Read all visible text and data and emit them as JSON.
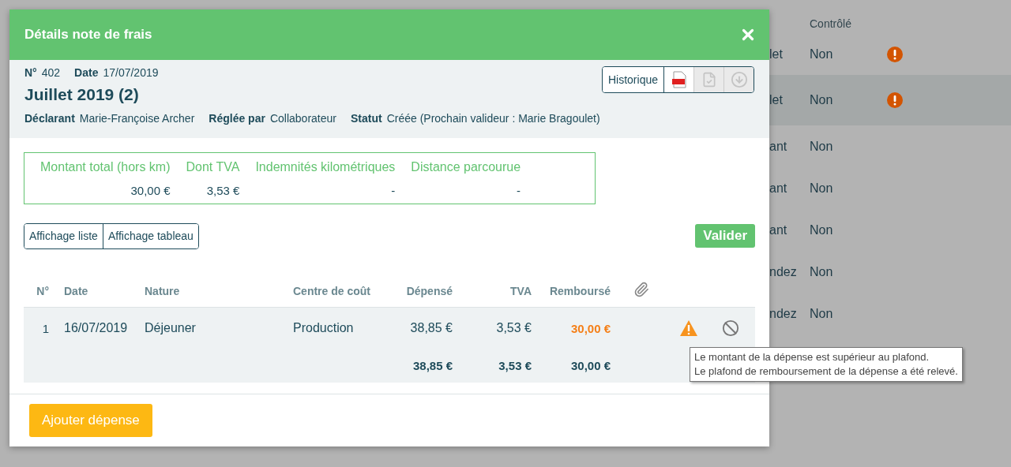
{
  "background": {
    "columns": [
      {
        "label": "Contrôlé"
      }
    ],
    "rows": [
      {
        "column_1": "let",
        "controle": "Non",
        "alert": true,
        "selected": false
      },
      {
        "column_1": "let",
        "controle": "Non",
        "alert": true,
        "selected": true
      },
      {
        "column_1": "ant",
        "controle": "Non",
        "alert": false,
        "selected": false
      },
      {
        "column_1": "ant",
        "controle": "Non",
        "alert": false,
        "selected": false
      },
      {
        "column_1": "ant",
        "controle": "Non",
        "alert": false,
        "selected": false
      },
      {
        "column_1": "ndez",
        "controle": "Non",
        "alert": false,
        "selected": false
      },
      {
        "column_1": "ndez",
        "controle": "Non",
        "alert": false,
        "selected": false
      }
    ]
  },
  "dialog": {
    "title": "Détails note de frais",
    "meta": [
      {
        "label": "N°",
        "value": "402"
      },
      {
        "label": "Date",
        "value": "17/07/2019"
      }
    ],
    "heading": "Juillet 2019 (2)",
    "details": [
      {
        "label": "Déclarant",
        "value": "Marie-Françoise Archer"
      },
      {
        "label": "Réglée par",
        "value": "Collaborateur"
      },
      {
        "label": "Statut",
        "value": "Créée (Prochain valideur : Marie Bragoulet)"
      }
    ],
    "toolbar": [
      {
        "kind": "text",
        "label": "Historique",
        "disabled": false
      },
      {
        "kind": "pdf",
        "disabled": false
      },
      {
        "kind": "approve",
        "disabled": true
      },
      {
        "kind": "download",
        "disabled": true
      }
    ],
    "summary": [
      {
        "label": "Montant total (hors km)",
        "value": "30,00 €"
      },
      {
        "label": "Dont TVA",
        "value": "3,53 €"
      },
      {
        "label": "Indemnités kilométriques",
        "value": "-"
      },
      {
        "label": "Distance parcourue",
        "value": "-"
      }
    ],
    "view_buttons": [
      "Affichage liste",
      "Affichage tableau"
    ],
    "validate_button": "Valider",
    "table": {
      "columns": [
        "N°",
        "Date",
        "Nature",
        "Centre de coût",
        "Dépensé",
        "TVA",
        "Remboursé"
      ],
      "rows": [
        {
          "no": "1",
          "date": "16/07/2019",
          "nature": "Déjeuner",
          "cost_center": "Production",
          "spent": "38,85 €",
          "vat": "3,53 €",
          "refunded": "30,00 €",
          "over_limit": true
        }
      ],
      "totals": {
        "spent": "38,85 €",
        "vat": "3,53 €",
        "refunded": "30,00 €"
      }
    },
    "tooltip": [
      "Le montant de la dépense est supérieur au plafond.",
      "Le plafond de remboursement de la dépense a été relevé."
    ],
    "add_button": "Ajouter dépense"
  }
}
